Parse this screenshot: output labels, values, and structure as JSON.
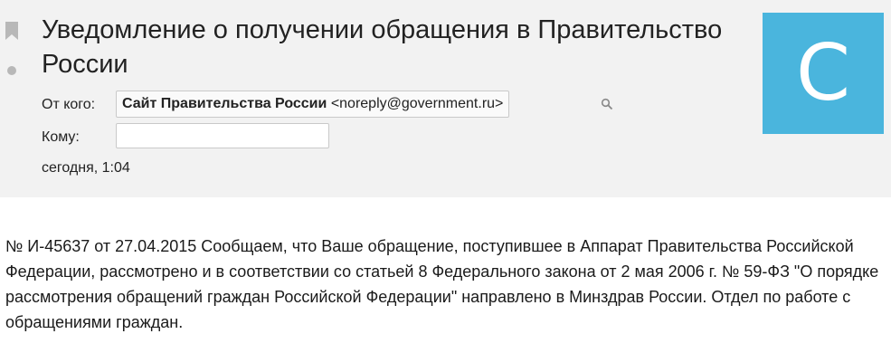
{
  "message": {
    "subject": "Уведомление о получении обращения в Правительство России",
    "from_label": "От кого:",
    "sender_name": "Сайт Правительства России",
    "sender_email": "<noreply@government.ru>",
    "to_label": "Кому:",
    "date": "сегодня, 1:04",
    "avatar_letter": "C",
    "body": "№ И-45637 от 27.04.2015 Сообщаем, что Ваше обращение, поступившее в Аппарат Правительства Российской Федерации, рассмотрено и в соответствии со статьей 8 Федерального закона от 2 мая 2006 г. № 59-ФЗ \"О порядке рассмотрения обращений граждан Российской Федерации\" направлено в Минздрав России. Отдел по работе с обращениями граждан."
  },
  "colors": {
    "header_bg": "#f2f2f2",
    "avatar_bg": "#4ab5dd",
    "icon_gray": "#b8b8b8"
  },
  "icons": {
    "flag": "bookmark-icon",
    "read_status": "dot-icon",
    "search": "magnifier-icon"
  }
}
